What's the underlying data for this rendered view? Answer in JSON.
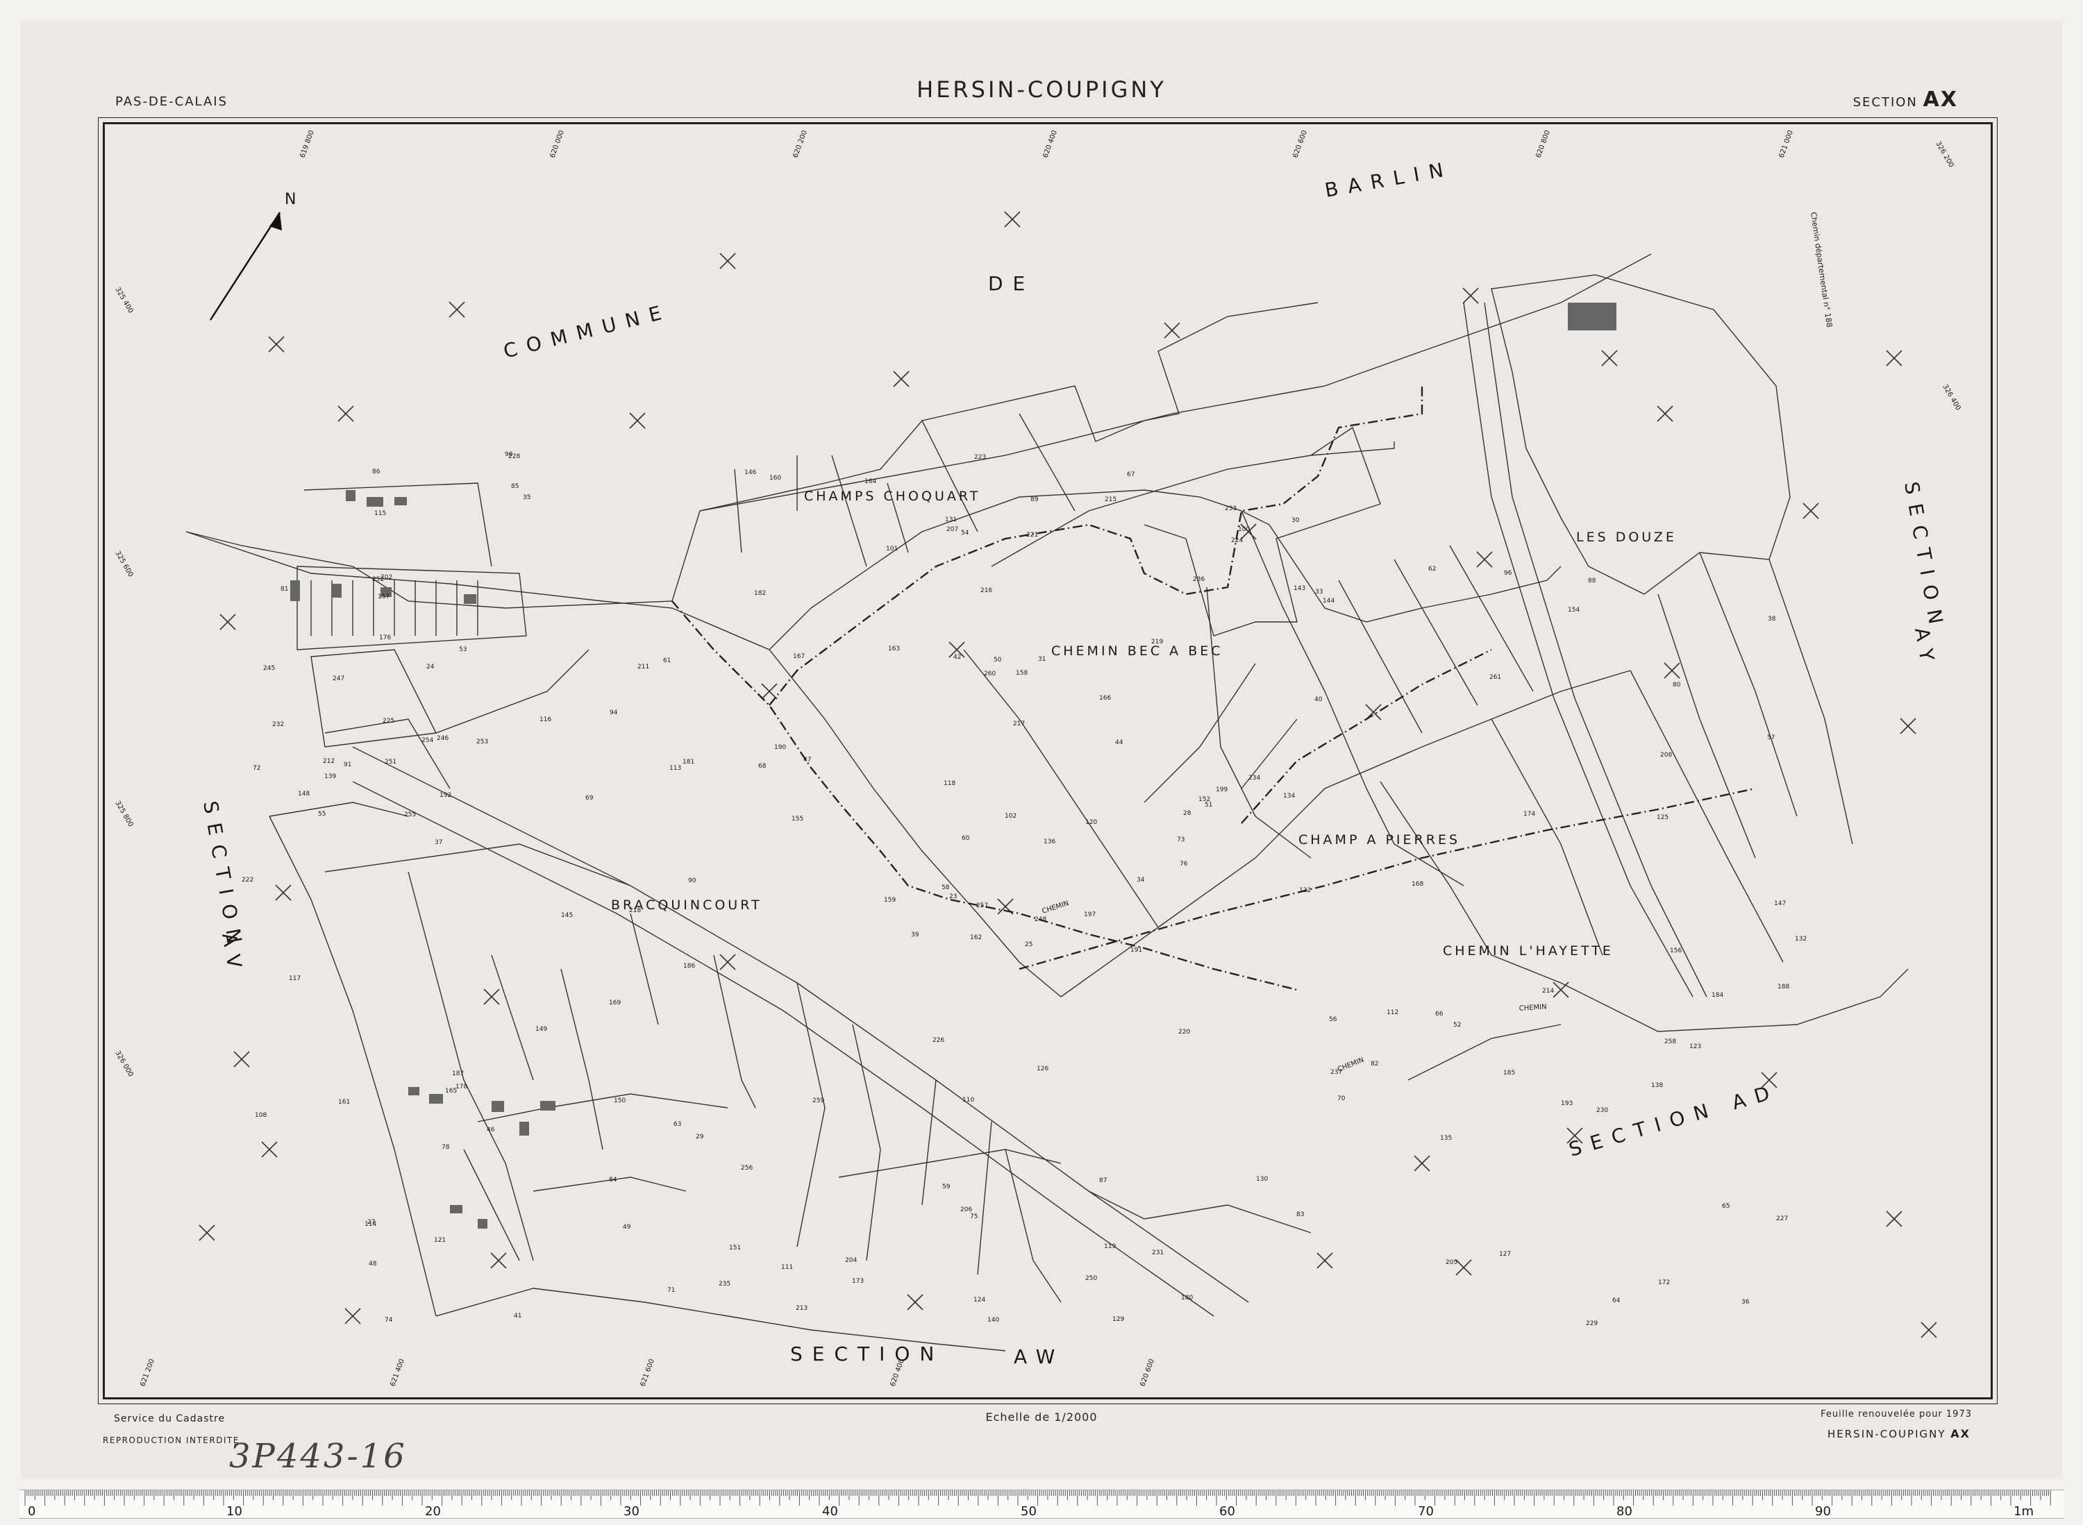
{
  "header": {
    "department": "PAS-DE-CALAIS",
    "commune": "HERSIN-COUPIGNY",
    "section_prefix": "SECTION",
    "section_letters": "AX"
  },
  "map": {
    "north_label": "N",
    "neighbour_labels": {
      "commune": "COMMUNE",
      "de": "DE",
      "barlin": "BARLIN",
      "section_av_1": "SECTION",
      "section_av_2": "AV",
      "section_aw_1": "SECTION",
      "section_aw_2": "AW",
      "section_ad": "SECTION AD",
      "section_ay_1": "SECTION",
      "section_ay_2": "AY"
    },
    "place_names": {
      "champs_choquart": "CHAMPS CHOQUART",
      "chemin_bec_a_bec": "CHEMIN BEC A BEC",
      "les_douze": "LES DOUZE",
      "champ_a_pierres": "CHAMP A PIERRES",
      "bracquincourt": "BRACQUINCOURT",
      "chemin_lhayette": "CHEMIN L'HAYETTE"
    },
    "parcel_numbers": [
      "25",
      "24",
      "23",
      "27",
      "28",
      "29",
      "30",
      "31",
      "33",
      "34",
      "35",
      "36",
      "37",
      "38",
      "39",
      "40",
      "41",
      "42",
      "44",
      "46",
      "47",
      "48",
      "49",
      "50",
      "51",
      "52",
      "53",
      "54",
      "55",
      "56",
      "57",
      "58",
      "59",
      "60",
      "61",
      "62",
      "63",
      "64",
      "65",
      "66",
      "67",
      "68",
      "69",
      "70",
      "71",
      "72",
      "73",
      "74",
      "75",
      "76",
      "78",
      "80",
      "81",
      "82",
      "83",
      "84",
      "85",
      "86",
      "87",
      "88",
      "89",
      "90",
      "91",
      "94",
      "96",
      "98",
      "100",
      "101",
      "102",
      "108",
      "110",
      "111",
      "112",
      "113",
      "114",
      "115",
      "116",
      "117",
      "118",
      "119",
      "120",
      "121",
      "122",
      "123",
      "124",
      "125",
      "126",
      "127",
      "129",
      "130",
      "131",
      "132",
      "134",
      "135",
      "136",
      "138",
      "139",
      "140",
      "143",
      "144",
      "145",
      "146",
      "147",
      "148",
      "149",
      "150",
      "151",
      "152",
      "154",
      "155",
      "156",
      "157",
      "158",
      "159",
      "160",
      "161",
      "162",
      "163",
      "164",
      "165",
      "166",
      "167",
      "168",
      "169",
      "172",
      "173",
      "174",
      "176",
      "178",
      "180",
      "181",
      "182",
      "184",
      "185",
      "186",
      "187",
      "188",
      "190",
      "191",
      "192",
      "193",
      "197",
      "199",
      "202",
      "204",
      "205",
      "206",
      "207",
      "208",
      "211",
      "212",
      "213",
      "214",
      "215",
      "216",
      "217",
      "218",
      "219",
      "220",
      "221",
      "222",
      "223",
      "224",
      "225",
      "226",
      "227",
      "228",
      "229",
      "230",
      "231",
      "232",
      "233",
      "234",
      "235",
      "236",
      "237",
      "245",
      "246",
      "247",
      "248",
      "250",
      "251",
      "252",
      "253",
      "254",
      "255",
      "256",
      "257",
      "258",
      "259",
      "260",
      "261"
    ],
    "road_labels": [
      "CHEMIN",
      "CHEMIN",
      "CHEMIN"
    ],
    "grid_labels": [
      "619 800",
      "620 000",
      "620 200",
      "620 400",
      "620 600",
      "620 800",
      "621 000",
      "621 200",
      "621 400",
      "621 600",
      "620 400",
      "620 600",
      "325 400",
      "325 600",
      "325 800",
      "326 000",
      "326 200",
      "326 400"
    ],
    "dept_road_label": "Chemin départemental n° 188"
  },
  "footer": {
    "service": "Service du Cadastre",
    "reproduction": "REPRODUCTION INTERDITE",
    "scale": "Echelle de 1/2000",
    "renewed": "Feuille renouvelée pour 1973",
    "sheet_ref_name": "HERSIN-COUPIGNY",
    "sheet_ref_section": "AX",
    "archive_ref": "3P443-16"
  },
  "ruler": {
    "major_labels": [
      "0",
      "10",
      "20",
      "30",
      "40",
      "50",
      "60",
      "70",
      "80",
      "90",
      "1m"
    ]
  }
}
